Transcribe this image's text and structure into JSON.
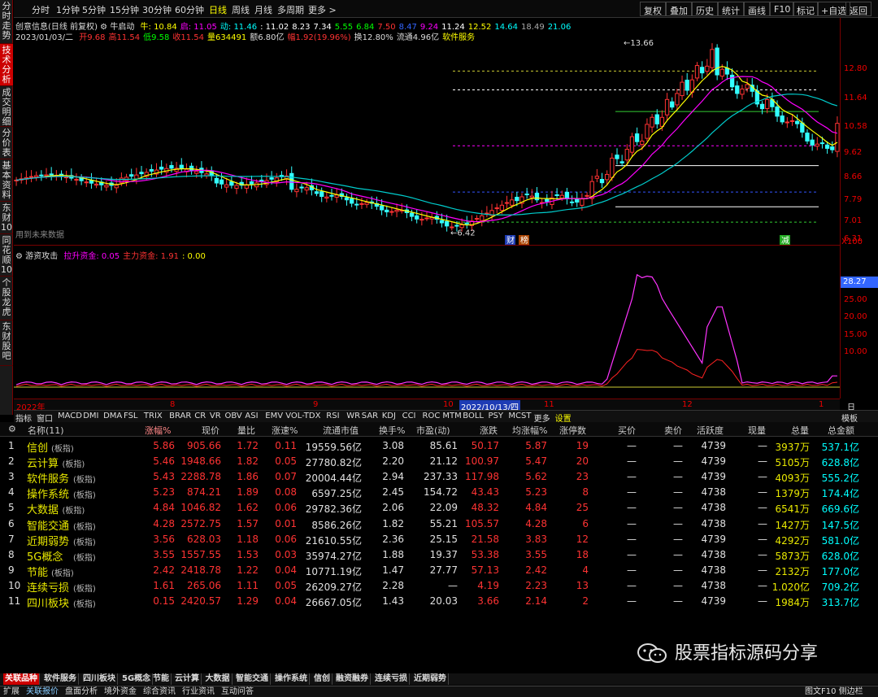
{
  "left_tabs": [
    "分时走势",
    "技术分析",
    "成交明细",
    "分价表",
    "基本资料",
    "东财10",
    "同花顺10",
    "个股龙虎",
    "东财股吧"
  ],
  "toolbar": {
    "timeframes": [
      "分时",
      "1分钟",
      "5分钟",
      "15分钟",
      "30分钟",
      "60分钟",
      "日线",
      "周线",
      "月线",
      "多周期",
      "更多 >"
    ],
    "active_timeframe": "日线",
    "right_buttons": [
      "复权",
      "叠加",
      "历史",
      "统计",
      "画线",
      "F10",
      "标记",
      "+自选",
      "返回"
    ]
  },
  "info1": {
    "title": "创意信息(日线 前复权)",
    "indicator": "牛启动",
    "items": [
      {
        "t": "牛: 10.84",
        "c": "#ffff00"
      },
      {
        "t": "启: 11.05",
        "c": "#ff00ff"
      },
      {
        "t": "动: 11.46",
        "c": "#00ffff"
      },
      {
        "t": ": 11.02",
        "c": "#ffffff"
      },
      {
        "t": "8.23",
        "c": "#ffffff"
      },
      {
        "t": "7.34",
        "c": "#ffffff"
      },
      {
        "t": "5.55",
        "c": "#00ff00"
      },
      {
        "t": "6.84",
        "c": "#00ff00"
      },
      {
        "t": "7.50",
        "c": "#ff3333"
      },
      {
        "t": "8.47",
        "c": "#3366ff"
      },
      {
        "t": "9.24",
        "c": "#ff00ff"
      },
      {
        "t": "11.24",
        "c": "#ffffff"
      },
      {
        "t": "12.52",
        "c": "#ffff00"
      },
      {
        "t": "14.64",
        "c": "#00ffff"
      },
      {
        "t": "18.49",
        "c": "#aaaaaa"
      },
      {
        "t": "21.06",
        "c": "#00ffff"
      }
    ]
  },
  "info2": {
    "date": "2023/01/03/二",
    "items": [
      {
        "t": "开9.68",
        "c": "#ff3333"
      },
      {
        "t": "高11.54",
        "c": "#ff3333"
      },
      {
        "t": "低9.58",
        "c": "#00ff00"
      },
      {
        "t": "收11.54",
        "c": "#ff3333"
      },
      {
        "t": "量634491",
        "c": "#ffff00"
      },
      {
        "t": "额6.80亿",
        "c": "#dddddd"
      },
      {
        "t": "幅1.92(19.96%)",
        "c": "#ff3333"
      },
      {
        "t": "换12.80%",
        "c": "#dddddd"
      },
      {
        "t": "流通4.96亿",
        "c": "#dddddd"
      },
      {
        "t": "软件服务",
        "c": "#ffff00"
      }
    ]
  },
  "future_data_label": "用到未来数据",
  "chart_marks": {
    "high_label": "13.66",
    "low_label": "6.42",
    "badge1": "财",
    "badge2": "榜",
    "badge3": "减"
  },
  "price_axis": {
    "labels": [
      "12.80",
      "11.64",
      "10.58",
      "9.62",
      "8.66",
      "7.79",
      "7.01",
      "6.31"
    ],
    "multiplier": "X100"
  },
  "indicator_pane": {
    "name": "游资攻击",
    "items": [
      {
        "t": "拉升资金: 0.05",
        "c": "#ff00ff"
      },
      {
        "t": "主力资金: 1.91",
        "c": "#ff3333"
      },
      {
        "t": ": 0.00",
        "c": "#ffff00"
      }
    ],
    "axis_labels": [
      "25.00",
      "20.00",
      "15.00",
      "10.00"
    ],
    "current_value": "28.27"
  },
  "date_axis": {
    "labels": [
      "2022年",
      "8",
      "9",
      "10",
      "11",
      "12",
      "1"
    ],
    "cursor_date": "2022/10/13/四",
    "right_label": "日线"
  },
  "indicator_tabs": [
    "指标",
    "窗口",
    "MACD",
    "DMI",
    "DMA",
    "FSL",
    "TRIX",
    "BRAR",
    "CR",
    "VR",
    "OBV",
    "ASI",
    "EMV",
    "VOL-TDX",
    "RSI",
    "WR",
    "SAR",
    "KDJ",
    "CCI",
    "ROC",
    "MTM",
    "BOLL",
    "PSY",
    "MCST",
    "更多",
    "设置"
  ],
  "indicator_tabs_right": "模板",
  "table": {
    "headers": [
      "名称(11)",
      "涨幅%",
      "现价",
      "量比",
      "涨速%",
      "流通市值",
      "换手%",
      "市盈(动)",
      "涨跌",
      "均涨幅%",
      "涨停数",
      "买价",
      "卖价",
      "活跃度",
      "现量",
      "总量",
      "总金额"
    ],
    "rows": [
      {
        "i": "1",
        "name": "信创",
        "tag": "(板指)",
        "chg": "5.86",
        "price": "905.66",
        "vr": "1.72",
        "spd": "0.11",
        "mcap": "19559.56亿",
        "turn": "3.08",
        "pe": "85.61",
        "diff": "50.17",
        "avg": "5.87",
        "lim": "19",
        "bid": "—",
        "ask": "—",
        "act": "4739",
        "cur": "—",
        "vol": "3937万",
        "amt": "537.1亿"
      },
      {
        "i": "2",
        "name": "云计算",
        "tag": "(板指)",
        "chg": "5.46",
        "price": "1948.66",
        "vr": "1.82",
        "spd": "0.05",
        "mcap": "27780.82亿",
        "turn": "2.20",
        "pe": "21.12",
        "diff": "100.97",
        "avg": "5.47",
        "lim": "20",
        "bid": "—",
        "ask": "—",
        "act": "4739",
        "cur": "—",
        "vol": "5105万",
        "amt": "628.8亿"
      },
      {
        "i": "3",
        "name": "软件服务",
        "tag": "(板指)",
        "chg": "5.43",
        "price": "2288.78",
        "vr": "1.86",
        "spd": "0.07",
        "mcap": "20004.44亿",
        "turn": "2.94",
        "pe": "237.33",
        "diff": "117.98",
        "avg": "5.62",
        "lim": "23",
        "bid": "—",
        "ask": "—",
        "act": "4739",
        "cur": "—",
        "vol": "4093万",
        "amt": "555.2亿"
      },
      {
        "i": "4",
        "name": "操作系统",
        "tag": "(板指)",
        "chg": "5.23",
        "price": "874.21",
        "vr": "1.89",
        "spd": "0.08",
        "mcap": "6597.25亿",
        "turn": "2.45",
        "pe": "154.72",
        "diff": "43.43",
        "avg": "5.23",
        "lim": "8",
        "bid": "—",
        "ask": "—",
        "act": "4738",
        "cur": "—",
        "vol": "1379万",
        "amt": "174.4亿"
      },
      {
        "i": "5",
        "name": "大数据",
        "tag": "(板指)",
        "chg": "4.84",
        "price": "1046.82",
        "vr": "1.62",
        "spd": "0.06",
        "mcap": "29782.36亿",
        "turn": "2.06",
        "pe": "22.09",
        "diff": "48.32",
        "avg": "4.84",
        "lim": "25",
        "bid": "—",
        "ask": "—",
        "act": "4738",
        "cur": "—",
        "vol": "6541万",
        "amt": "669.6亿"
      },
      {
        "i": "6",
        "name": "智能交通",
        "tag": "(板指)",
        "chg": "4.28",
        "price": "2572.75",
        "vr": "1.57",
        "spd": "0.01",
        "mcap": "8586.26亿",
        "turn": "1.82",
        "pe": "55.21",
        "diff": "105.57",
        "avg": "4.28",
        "lim": "6",
        "bid": "—",
        "ask": "—",
        "act": "4738",
        "cur": "—",
        "vol": "1427万",
        "amt": "147.5亿"
      },
      {
        "i": "7",
        "name": "近期弱势",
        "tag": "(板指)",
        "chg": "3.56",
        "price": "628.03",
        "vr": "1.18",
        "spd": "0.06",
        "mcap": "21610.55亿",
        "turn": "2.36",
        "pe": "25.15",
        "diff": "21.58",
        "avg": "3.83",
        "lim": "12",
        "bid": "—",
        "ask": "—",
        "act": "4739",
        "cur": "—",
        "vol": "4292万",
        "amt": "581.0亿"
      },
      {
        "i": "8",
        "name": "5G概念",
        "tag": "(板指)",
        "chg": "3.55",
        "price": "1557.55",
        "vr": "1.53",
        "spd": "0.03",
        "mcap": "35974.27亿",
        "turn": "1.88",
        "pe": "19.37",
        "diff": "53.38",
        "avg": "3.55",
        "lim": "18",
        "bid": "—",
        "ask": "—",
        "act": "4738",
        "cur": "—",
        "vol": "5873万",
        "amt": "628.0亿"
      },
      {
        "i": "9",
        "name": "节能",
        "tag": "(板指)",
        "chg": "2.42",
        "price": "2418.78",
        "vr": "1.22",
        "spd": "0.04",
        "mcap": "10771.19亿",
        "turn": "1.47",
        "pe": "27.77",
        "diff": "57.13",
        "avg": "2.42",
        "lim": "4",
        "bid": "—",
        "ask": "—",
        "act": "4738",
        "cur": "—",
        "vol": "2132万",
        "amt": "177.0亿"
      },
      {
        "i": "10",
        "name": "连续亏损",
        "tag": "(板指)",
        "chg": "1.61",
        "price": "265.06",
        "vr": "1.11",
        "spd": "0.05",
        "mcap": "26209.27亿",
        "turn": "2.28",
        "pe": "—",
        "diff": "4.19",
        "avg": "2.23",
        "lim": "13",
        "bid": "—",
        "ask": "—",
        "act": "4738",
        "cur": "—",
        "vol": "1.020亿",
        "amt": "709.2亿"
      },
      {
        "i": "11",
        "name": "四川板块",
        "tag": "(板指)",
        "chg": "0.15",
        "price": "2420.57",
        "vr": "1.29",
        "spd": "0.04",
        "mcap": "26667.05亿",
        "turn": "1.43",
        "pe": "20.03",
        "diff": "3.66",
        "avg": "2.14",
        "lim": "2",
        "bid": "—",
        "ask": "—",
        "act": "4739",
        "cur": "—",
        "vol": "1984万",
        "amt": "313.7亿"
      }
    ]
  },
  "watermark": "股票指标源码分享",
  "sector_tabs": [
    "关联品种",
    "软件服务",
    "四川板块",
    "5G概念",
    "节能",
    "云计算",
    "大数据",
    "智能交通",
    "操作系统",
    "信创",
    "融资融券",
    "连续亏损",
    "近期弱势"
  ],
  "bottom_tabs": [
    "扩展",
    "关联报价",
    "盘面分析",
    "境外资金",
    "综合资讯",
    "行业资讯",
    "互动问答"
  ],
  "bottom_right": "图文F10 侧边栏"
}
